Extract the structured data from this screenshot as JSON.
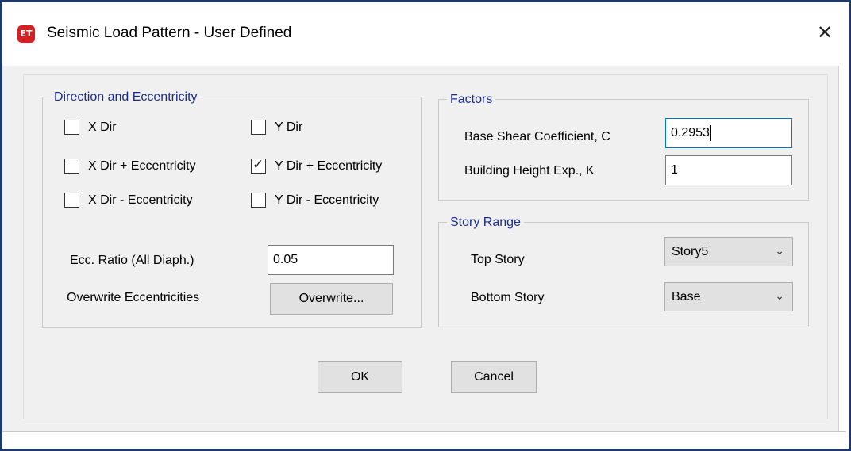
{
  "window": {
    "title": "Seismic Load Pattern - User Defined",
    "app_icon": "ET",
    "close_glyph": "✕"
  },
  "direction": {
    "legend": "Direction and Eccentricity",
    "checkboxes": [
      {
        "label": "X Dir",
        "checked": false
      },
      {
        "label": "Y Dir",
        "checked": false
      },
      {
        "label": "X Dir + Eccentricity",
        "checked": false
      },
      {
        "label": "Y Dir + Eccentricity",
        "checked": true
      },
      {
        "label": "X Dir - Eccentricity",
        "checked": false
      },
      {
        "label": "Y Dir - Eccentricity",
        "checked": false
      }
    ],
    "ecc_ratio_label": "Ecc. Ratio (All Diaph.)",
    "ecc_ratio_value": "0.05",
    "overwrite_label": "Overwrite Eccentricities",
    "overwrite_button": "Overwrite..."
  },
  "factors": {
    "legend": "Factors",
    "base_shear_label": "Base Shear Coefficient, C",
    "base_shear_value": "0.2953",
    "height_exp_label": "Building Height Exp., K",
    "height_exp_value": "1"
  },
  "story_range": {
    "legend": "Story Range",
    "top_label": "Top Story",
    "top_value": "Story5",
    "bottom_label": "Bottom Story",
    "bottom_value": "Base"
  },
  "buttons": {
    "ok": "OK",
    "cancel": "Cancel"
  },
  "colors": {
    "group_legend": "#1a2d8f",
    "focus_border": "#0078d7",
    "app_icon_bg": "#d42020",
    "window_frame": "#1f3a66"
  }
}
